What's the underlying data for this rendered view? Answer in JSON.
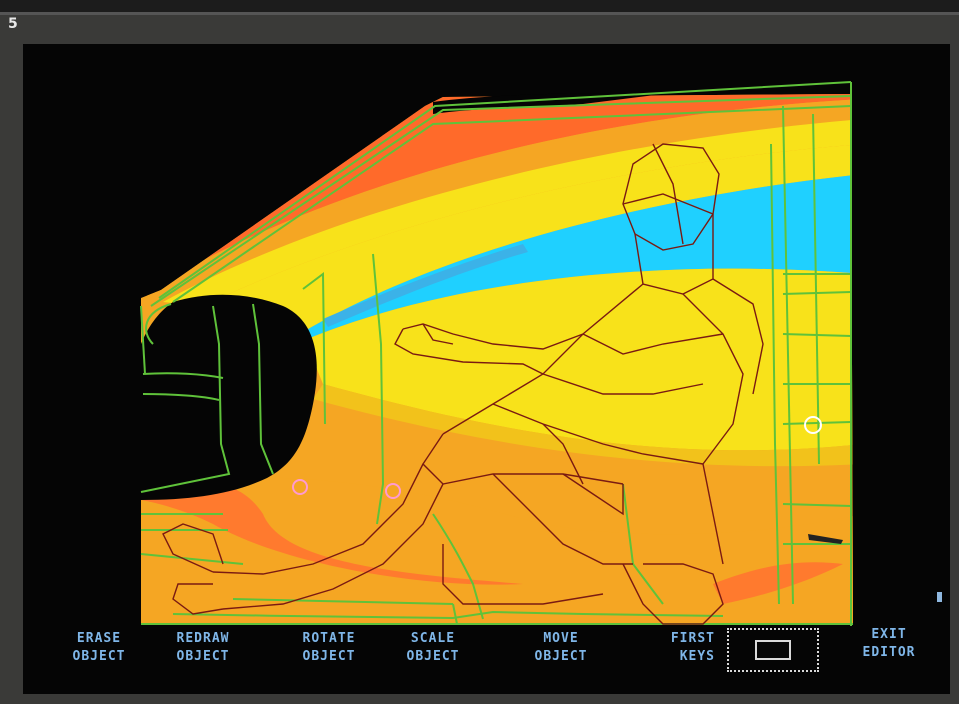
{
  "page_number": "5",
  "menu": [
    {
      "line1": "ERASE",
      "line2": "OBJECT"
    },
    {
      "line1": "REDRAW",
      "line2": "OBJECT"
    },
    {
      "line1": "ROTATE",
      "line2": "OBJECT"
    },
    {
      "line1": "SCALE",
      "line2": "OBJECT"
    },
    {
      "line1": "MOVE",
      "line2": "OBJECT"
    },
    {
      "line1": "FIRST",
      "line2": "KEYS"
    },
    {
      "line1": "EXIT",
      "line2": "EDITOR"
    }
  ],
  "icons": {
    "viewport": "window-rectangle-icon",
    "cursor": "cursor-block-icon"
  },
  "colors": {
    "red_orange": "#ff6a2a",
    "orange": "#f7a321",
    "yellow": "#f8e21a",
    "cyan": "#1fd0ff",
    "wire_green": "#5fc23a",
    "menu_text": "#7fb6e8"
  }
}
